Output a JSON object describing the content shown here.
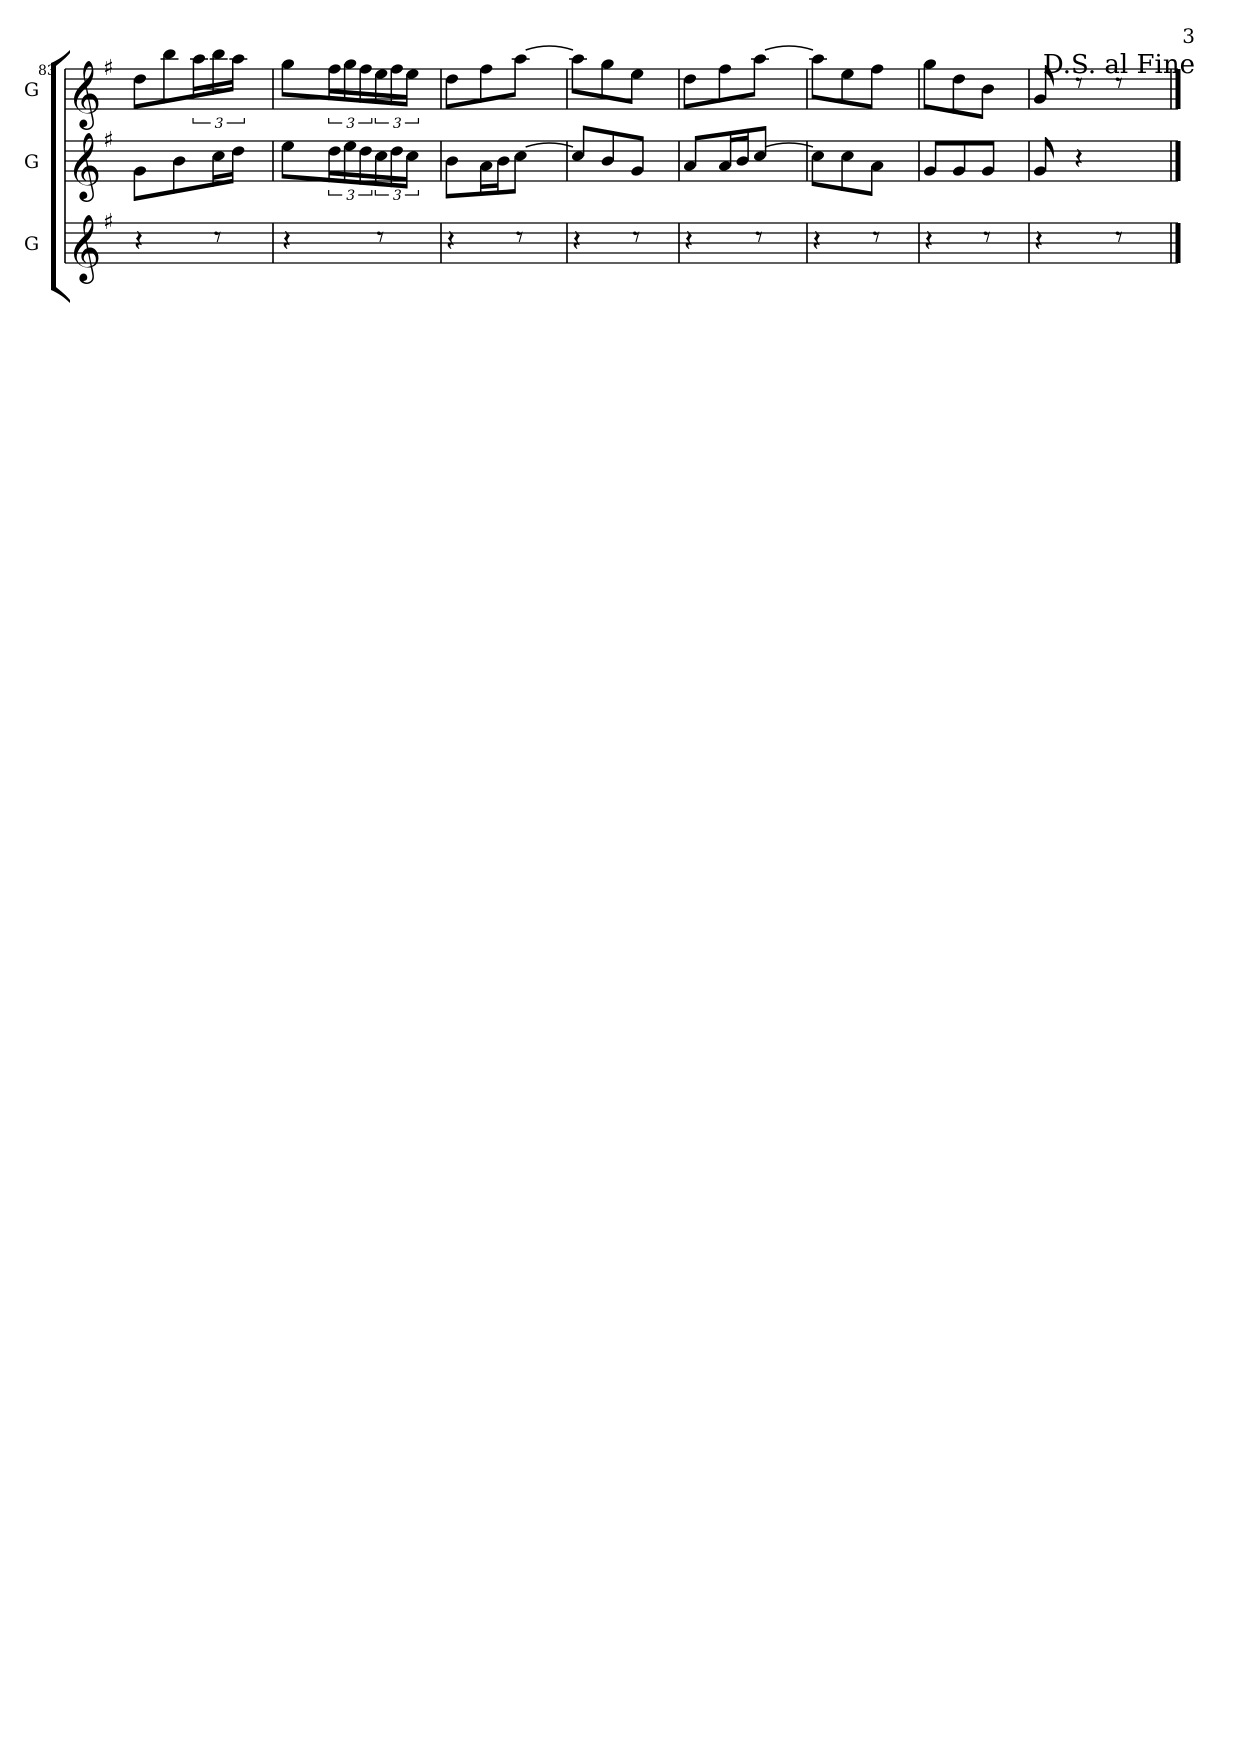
{
  "page": {
    "number": "3"
  },
  "directions": {
    "ds": "D.S. al Fine"
  },
  "system": {
    "start_measure": "83"
  },
  "key_signature": "G major (F#)",
  "clef": "treble",
  "staves": [
    {
      "label": "G",
      "part": "staff-1"
    },
    {
      "label": "G",
      "part": "staff-2"
    },
    {
      "label": "G",
      "part": "staff-3"
    }
  ],
  "tuplet_label": "3",
  "music": {
    "staff1": [
      [
        [
          "D5",
          0.5
        ],
        [
          "B5",
          0.5
        ],
        [
          "A5",
          0.333
        ],
        [
          "B5",
          0.333
        ],
        [
          "A5",
          0.333
        ]
      ],
      [
        [
          "G5",
          0.5
        ],
        [
          "F5",
          0.1667
        ],
        [
          "G5",
          0.1667
        ],
        [
          "F5",
          0.1667
        ],
        [
          "E5",
          0.1667
        ],
        [
          "F5",
          0.1667
        ],
        [
          "E5",
          0.1667
        ]
      ],
      [
        [
          "D5",
          0.5
        ],
        [
          "F5",
          0.5
        ],
        [
          "A5",
          0.5
        ]
      ],
      [
        [
          "A5",
          0.5
        ],
        [
          "G5",
          0.5
        ],
        [
          "E5",
          0.5
        ]
      ],
      [
        [
          "D5",
          0.5
        ],
        [
          "F5",
          0.5
        ],
        [
          "A5",
          0.5
        ]
      ],
      [
        [
          "A5",
          0.5
        ],
        [
          "E5",
          0.5
        ],
        [
          "F5",
          0.5
        ]
      ],
      [
        [
          "G5",
          0.5
        ],
        [
          "D5",
          0.5
        ],
        [
          "B4",
          0.5
        ]
      ],
      [
        [
          "G4",
          0.5
        ],
        [
          "r",
          0.5
        ],
        [
          "r",
          0.5
        ]
      ]
    ],
    "staff2": [
      [
        [
          "G4",
          0.5
        ],
        [
          "B4",
          0.5
        ],
        [
          "C5",
          0.25
        ],
        [
          "D5",
          0.25
        ]
      ],
      [
        [
          "E5",
          0.5
        ],
        [
          "D5",
          0.1667
        ],
        [
          "E5",
          0.1667
        ],
        [
          "D5",
          0.1667
        ],
        [
          "C5",
          0.1667
        ],
        [
          "D5",
          0.1667
        ],
        [
          "C5",
          0.1667
        ]
      ],
      [
        [
          "B4",
          0.5
        ],
        [
          "A4",
          0.25
        ],
        [
          "B4",
          0.25
        ],
        [
          "C5",
          0.5
        ]
      ],
      [
        [
          "C5",
          0.5
        ],
        [
          "B4",
          0.5
        ],
        [
          "G4",
          0.5
        ]
      ],
      [
        [
          "A4",
          0.5
        ],
        [
          "A4",
          0.25
        ],
        [
          "B4",
          0.25
        ],
        [
          "C5",
          0.5
        ]
      ],
      [
        [
          "C5",
          0.5
        ],
        [
          "C5",
          0.5
        ],
        [
          "A4",
          0.5
        ]
      ],
      [
        [
          "G4",
          0.5
        ],
        [
          "G4",
          0.5
        ],
        [
          "G4",
          0.5
        ]
      ],
      [
        [
          "G4",
          0.5
        ],
        [
          "r",
          1
        ]
      ]
    ],
    "staff3": [
      [
        [
          "r",
          1
        ],
        [
          "r",
          0.5
        ]
      ],
      [
        [
          "r",
          1
        ],
        [
          "r",
          0.5
        ]
      ],
      [
        [
          "r",
          1
        ],
        [
          "r",
          0.5
        ]
      ],
      [
        [
          "r",
          1
        ],
        [
          "r",
          0.5
        ]
      ],
      [
        [
          "r",
          1
        ],
        [
          "r",
          0.5
        ]
      ],
      [
        [
          "r",
          1
        ],
        [
          "r",
          0.5
        ]
      ],
      [
        [
          "r",
          1
        ],
        [
          "r",
          0.5
        ]
      ],
      [
        [
          "r",
          1
        ],
        [
          "r",
          0.5
        ]
      ]
    ]
  }
}
